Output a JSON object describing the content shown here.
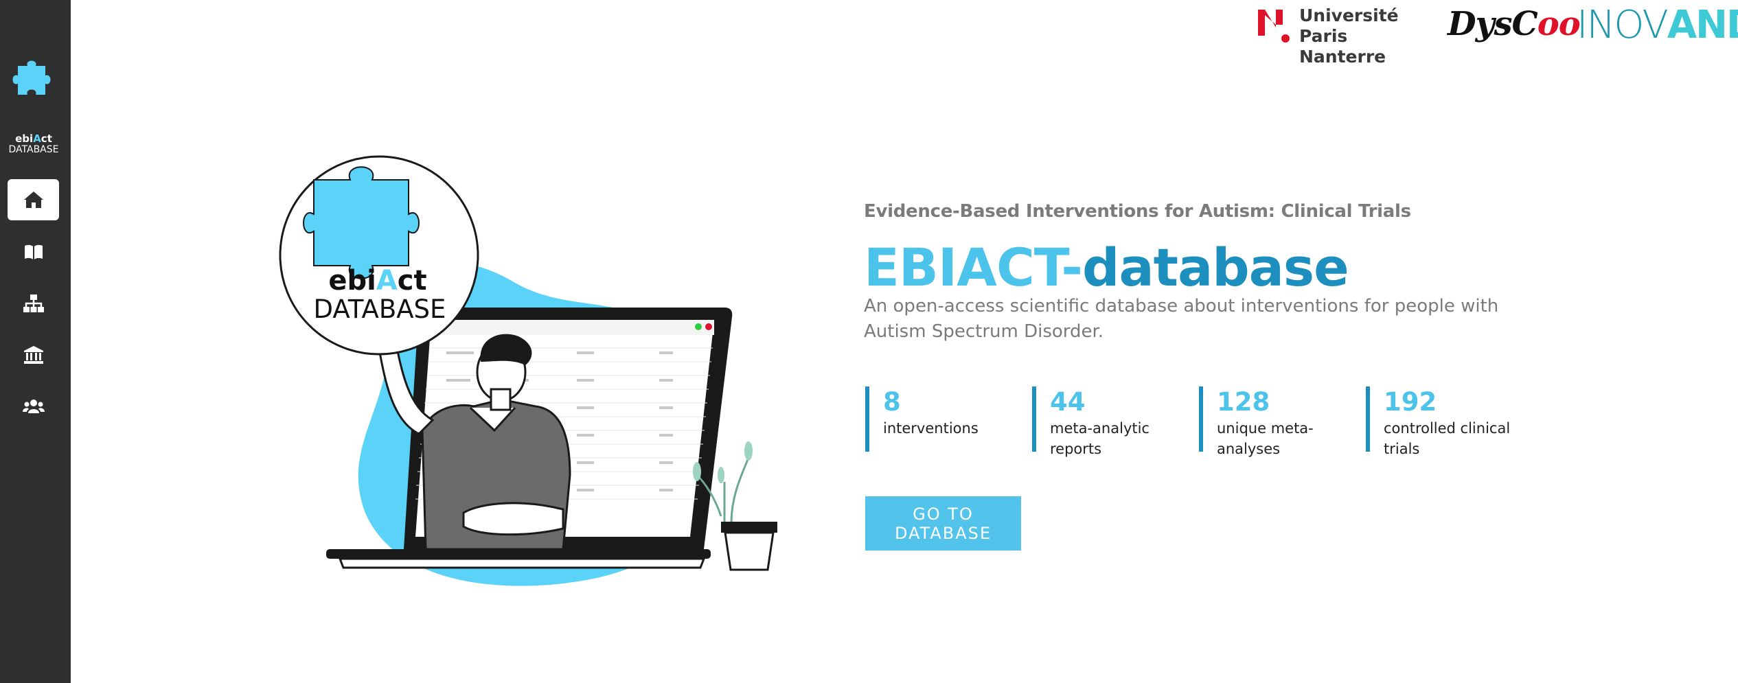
{
  "sidebar": {
    "logo": {
      "brand_pre": "ebi",
      "brand_a": "A",
      "brand_post": "ct",
      "sub": "DATABASE"
    },
    "items": [
      {
        "icon": "home-icon",
        "active": true
      },
      {
        "icon": "book-icon",
        "active": false
      },
      {
        "icon": "sitemap-icon",
        "active": false
      },
      {
        "icon": "institution-icon",
        "active": false
      },
      {
        "icon": "users-icon",
        "active": false
      }
    ]
  },
  "partners": {
    "upn_line1": "Université",
    "upn_line2": "Paris Nanterre",
    "dyscoo_text": "DysC",
    "dyscoo_inf": "oo",
    "inovand_text": "INOV",
    "inovand_and": "AND"
  },
  "illustration": {
    "badge_pre": "ebi",
    "badge_a": "A",
    "badge_post": "ct",
    "badge_sub": "DATABASE"
  },
  "hero": {
    "kicker": "Evidence-Based Interventions for Autism: Clinical Trials",
    "title_part1": "EBIACT-",
    "title_part2": "database",
    "description": "An open-access scientific database about interventions for people with Autism Spectrum Disorder.",
    "stats": [
      {
        "value": "8",
        "label": "interventions"
      },
      {
        "value": "44",
        "label": "meta-analytic reports"
      },
      {
        "value": "128",
        "label": "unique meta-analyses"
      },
      {
        "value": "192",
        "label": "controlled clinical trials"
      }
    ],
    "cta_label": "GO TO DATABASE"
  },
  "colors": {
    "sidebar_bg": "#2f2f2f",
    "accent_light": "#4cc3ea",
    "accent_dark": "#1d8fbe",
    "cta_bg": "#52c3ea"
  }
}
